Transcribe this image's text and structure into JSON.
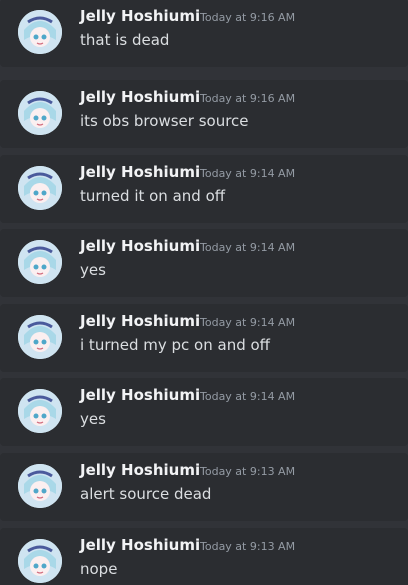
{
  "messages": [
    {
      "author": "Jelly Hoshiumi",
      "time": "Today at 9:16 AM",
      "text": "that is dead",
      "avatar_icon": "avatar-icon"
    },
    {
      "author": "Jelly Hoshiumi",
      "time": "Today at 9:16 AM",
      "text": "its obs browser source",
      "avatar_icon": "avatar-icon"
    },
    {
      "author": "Jelly Hoshiumi",
      "time": "Today at 9:14 AM",
      "text": "turned it on and off",
      "avatar_icon": "avatar-icon"
    },
    {
      "author": "Jelly Hoshiumi",
      "time": "Today at 9:14 AM",
      "text": "yes",
      "avatar_icon": "avatar-icon"
    },
    {
      "author": "Jelly Hoshiumi",
      "time": "Today at 9:14 AM",
      "text": "i turned my pc on and off",
      "avatar_icon": "avatar-icon"
    },
    {
      "author": "Jelly Hoshiumi",
      "time": "Today at 9:14 AM",
      "text": "yes",
      "avatar_icon": "avatar-icon"
    },
    {
      "author": "Jelly Hoshiumi",
      "time": "Today at 9:13 AM",
      "text": "alert source dead",
      "avatar_icon": "avatar-icon"
    },
    {
      "author": "Jelly Hoshiumi",
      "time": "Today at 9:13 AM",
      "text": "nope",
      "avatar_icon": "avatar-icon"
    }
  ],
  "colors": {
    "background": "#313338",
    "message_background": "#2b2d31",
    "author": "#f2f3f5",
    "timestamp": "#949ba4",
    "text": "#dbdee1"
  }
}
